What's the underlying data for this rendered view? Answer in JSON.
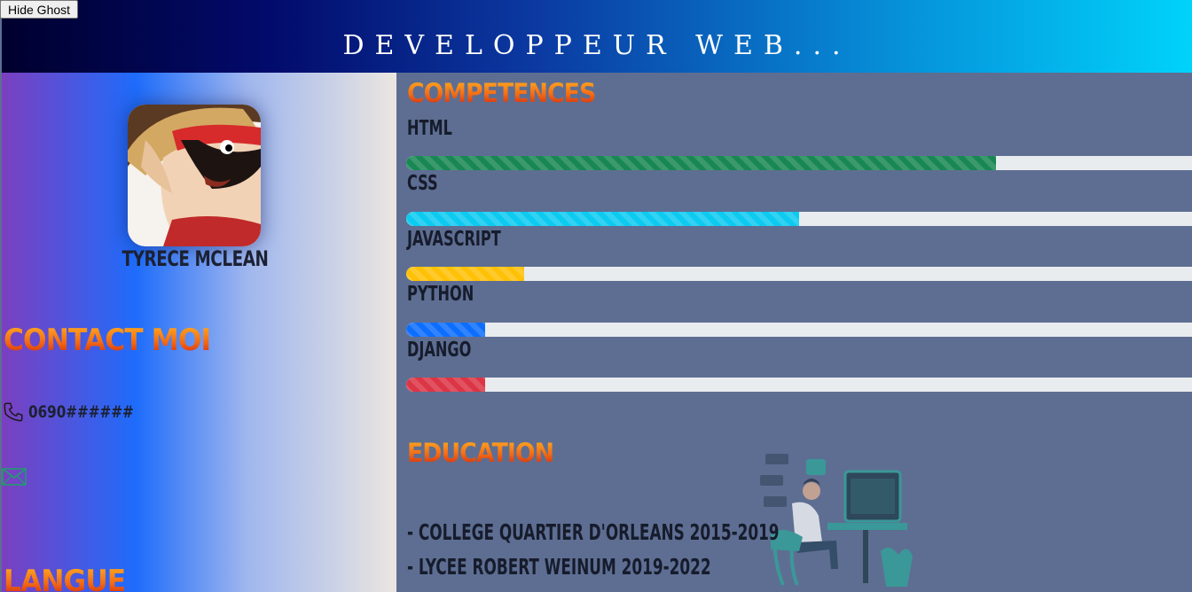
{
  "ghost_button": "Hide Ghost",
  "header": {
    "title": "DEVELOPPEUR WEB..."
  },
  "profile": {
    "name": "TYRECE MCLEAN"
  },
  "contact": {
    "title": "CONTACT MOI",
    "phone": "0690######"
  },
  "langue": {
    "title": "LANGUE"
  },
  "competences": {
    "title": "COMPETENCES",
    "skills": [
      {
        "label": "HTML",
        "level": 0.75,
        "color": "#198754"
      },
      {
        "label": "CSS",
        "level": 0.5,
        "color": "#0dcaf0"
      },
      {
        "label": "JAVASCRIPT",
        "level": 0.15,
        "color": "#ffc107"
      },
      {
        "label": "PYTHON",
        "level": 0.1,
        "color": "#0d6efd"
      },
      {
        "label": "DJANGO",
        "level": 0.1,
        "color": "#dc3545"
      }
    ]
  },
  "education": {
    "title": "EDUCATION",
    "items": [
      "- COLLEGE QUARTIER D'ORLEANS 2015-2019",
      "- LYCEE ROBERT WEINUM 2019-2022"
    ]
  },
  "icons": {
    "phone": "phone-icon",
    "mail": "mail-icon",
    "illustration": "developer-illustration"
  }
}
